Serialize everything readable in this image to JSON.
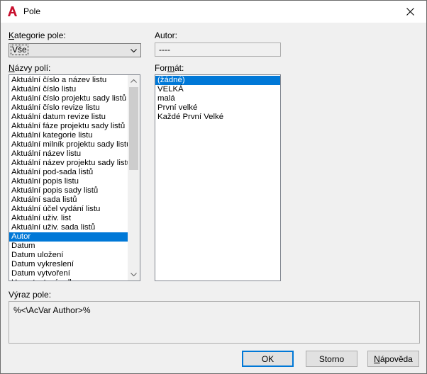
{
  "window": {
    "title": "Pole"
  },
  "category": {
    "label": "Kategorie pole:",
    "value": "Vše"
  },
  "author": {
    "label": "Autor:",
    "value": "----"
  },
  "field_names": {
    "label": "Názvy polí:",
    "items": [
      "Aktuální číslo a název listu",
      "Aktuální číslo listu",
      "Aktuální číslo projektu sady listů",
      "Aktuální číslo revize listu",
      "Aktuální datum revize listu",
      "Aktuální fáze projektu sady listů",
      "Aktuální kategorie listu",
      "Aktuální milník projektu sady listů",
      "Aktuální název listu",
      "Aktuální název projektu sady listů",
      "Aktuální pod-sada listů",
      "Aktuální popis listu",
      "Aktuální popis sady listů",
      "Aktuální sada listů",
      "Aktuální účel vydání listu",
      "Aktuální uživ. list",
      "Aktuální uživ. sada listů",
      "Autor",
      "Datum",
      "Datum uložení",
      "Datum vykreslení",
      "Datum vytvoření",
      "Hypertextový odkaz"
    ],
    "selected_index": 17
  },
  "format": {
    "label": "Formát:",
    "items": [
      "(žádné)",
      "VELKÁ",
      "malá",
      "První velké",
      "Každé První Velké"
    ],
    "selected_index": 0
  },
  "expression": {
    "label": "Výraz pole:",
    "value": "%<\\AcVar Author>%"
  },
  "buttons": {
    "ok": "OK",
    "cancel": "Storno",
    "help": "Nápověda"
  }
}
